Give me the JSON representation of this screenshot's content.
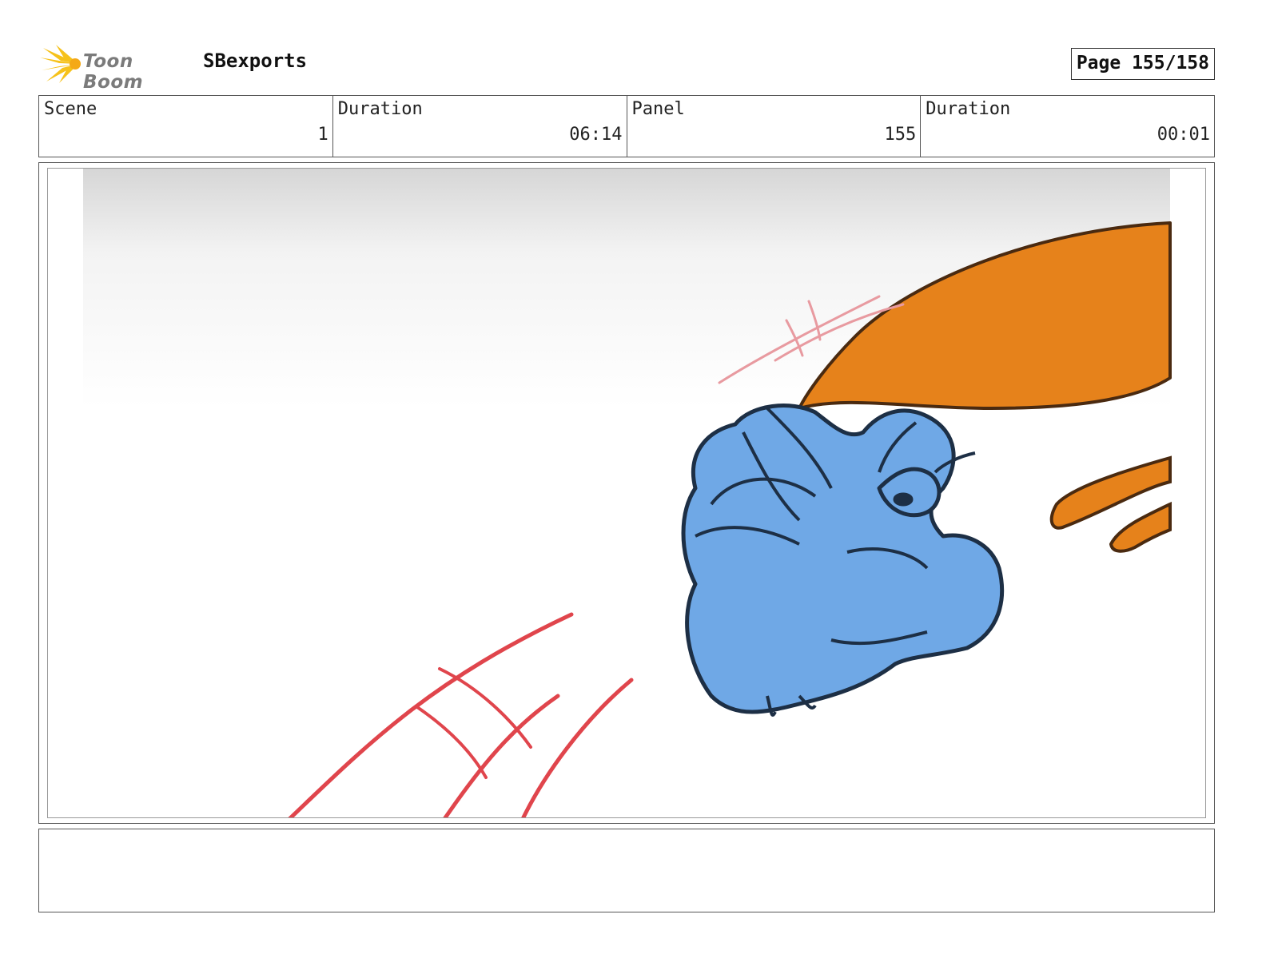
{
  "header": {
    "logo_text": "Toon Boom",
    "project_name": "SBexports",
    "page_label": "Page 155/158"
  },
  "info": {
    "scene_label": "Scene",
    "scene_value": "1",
    "scene_duration_label": "Duration",
    "scene_duration_value": "06:14",
    "panel_label": "Panel",
    "panel_value": "155",
    "panel_duration_label": "Duration",
    "panel_duration_value": "00:01"
  },
  "colors": {
    "character_fill": "#6fa8e6",
    "character_outline": "#1d2f45",
    "orange_fill": "#e6821b",
    "speed_lines": "#e0454c",
    "logo_yellow": "#f6c21b"
  },
  "notes": {
    "text": ""
  }
}
